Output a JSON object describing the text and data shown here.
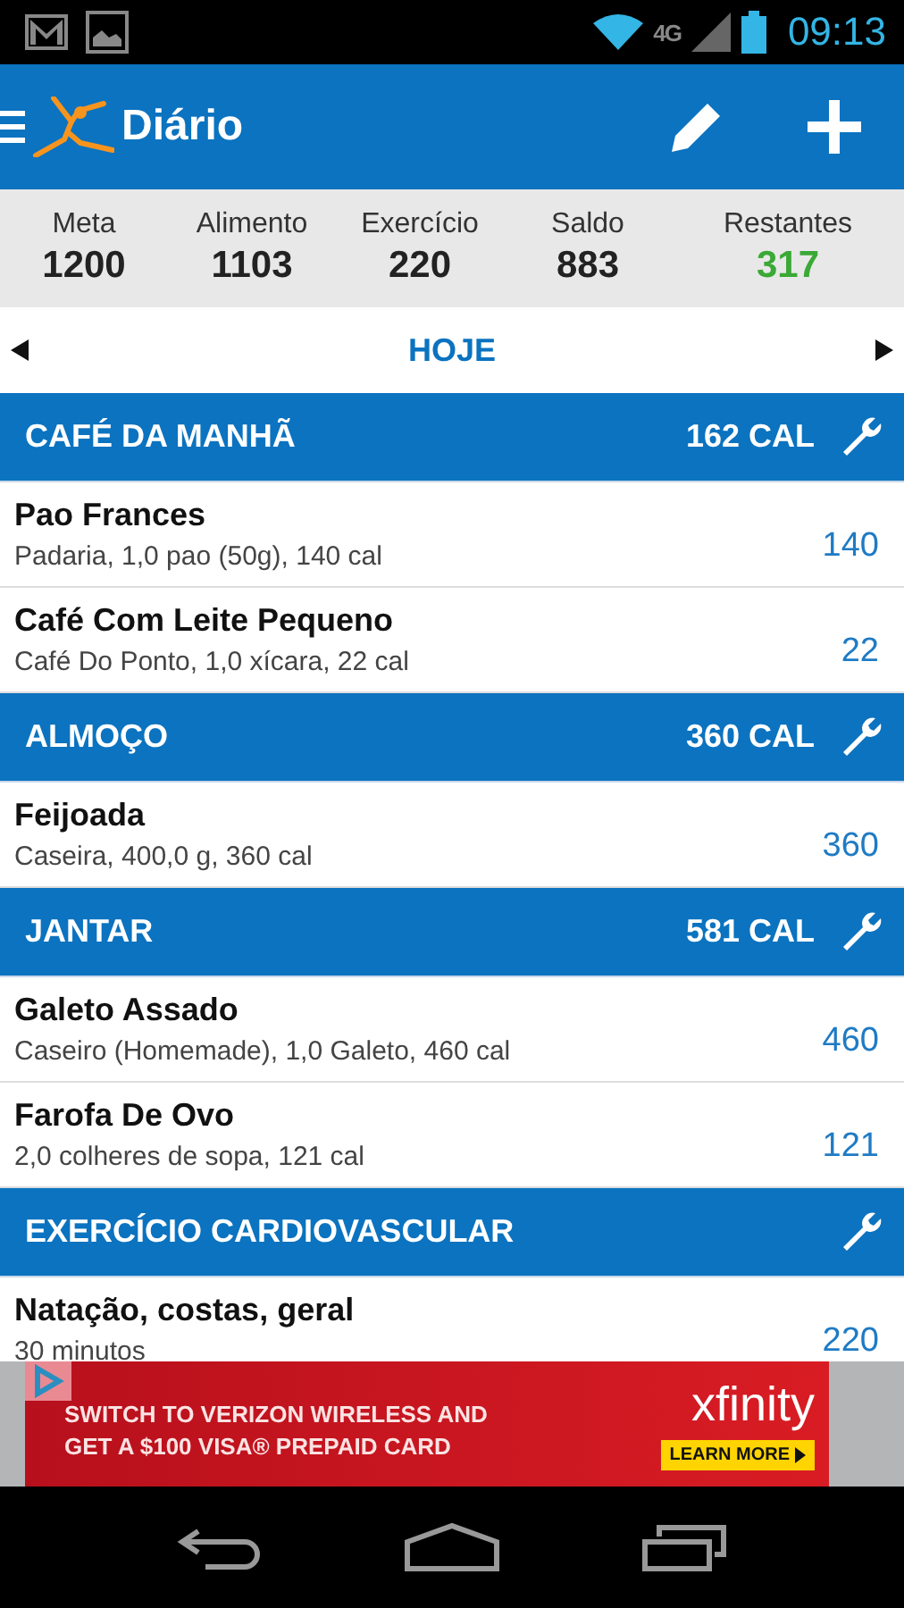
{
  "status_bar": {
    "network": "4G",
    "time": "09:13"
  },
  "app_bar": {
    "title": "Diário"
  },
  "summary": [
    {
      "label": "Meta",
      "value": "1200",
      "color": "#222222"
    },
    {
      "label": "Alimento",
      "value": "1103",
      "color": "#222222"
    },
    {
      "label": "Exercício",
      "value": "220",
      "color": "#222222"
    },
    {
      "label": "Saldo",
      "value": "883",
      "color": "#222222"
    },
    {
      "label": "Restantes",
      "value": "317",
      "color": "#3aa935"
    }
  ],
  "date_nav": {
    "label": "HOJE"
  },
  "sections": [
    {
      "title": "CAFÉ DA MANHÃ",
      "calories": "162 CAL",
      "items": [
        {
          "name": "Pao Frances",
          "detail": "Padaria, 1,0 pao (50g), 140 cal",
          "calories": "140"
        },
        {
          "name": "Café Com Leite Pequeno",
          "detail": "Café Do Ponto, 1,0 xícara, 22 cal",
          "calories": "22"
        }
      ]
    },
    {
      "title": "ALMOÇO",
      "calories": "360 CAL",
      "items": [
        {
          "name": "Feijoada",
          "detail": "Caseira, 400,0 g, 360 cal",
          "calories": "360"
        }
      ]
    },
    {
      "title": "JANTAR",
      "calories": "581 CAL",
      "items": [
        {
          "name": "Galeto Assado",
          "detail": "Caseiro (Homemade), 1,0 Galeto, 460 cal",
          "calories": "460"
        },
        {
          "name": "Farofa De Ovo",
          "detail": "2,0 colheres de sopa, 121 cal",
          "calories": "121"
        }
      ]
    },
    {
      "title": "EXERCÍCIO CARDIOVASCULAR",
      "items": [
        {
          "name": "Natação, costas, geral",
          "detail": "30 minutos",
          "calories": "220"
        }
      ]
    }
  ],
  "ad": {
    "lines": [
      "SWITCH TO VERIZON WIRELESS AND",
      "GET A $100 VISA® PREPAID CARD"
    ],
    "brand": "xfinity",
    "button": "LEARN MORE"
  }
}
